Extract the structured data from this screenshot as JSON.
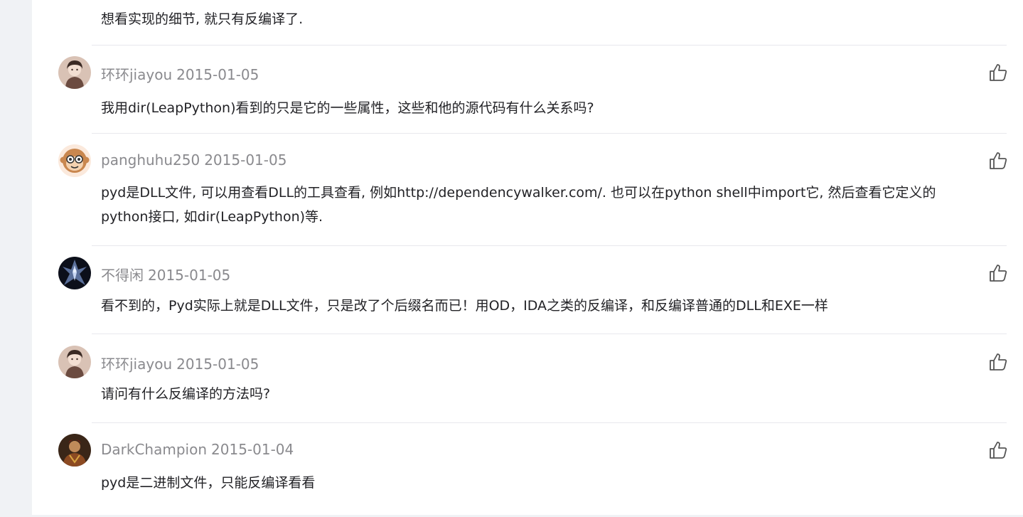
{
  "top_reply_text": "想看实现的细节, 就只有反编译了.",
  "comments": [
    {
      "user": "环环jiayou",
      "date": "2015-01-05",
      "text": "我用dir(LeapPython)看到的只是它的一些属性，这些和他的源代码有什么关系吗?",
      "avatar_icon": "girl-portrait-avatar"
    },
    {
      "user": "panghuhu250",
      "date": "2015-01-05",
      "text": "pyd是DLL文件, 可以用查看DLL的工具查看, 例如http://dependencywalker.com/. 也可以在python shell中import它, 然后查看它定义的python接口, 如dir(LeapPython)等.",
      "avatar_icon": "monkey-face-avatar"
    },
    {
      "user": "不得闲",
      "date": "2015-01-05",
      "text": "看不到的，Pyd实际上就是DLL文件，只是改了个后缀名而已！用OD，IDA之类的反编译，和反编译普通的DLL和EXE一样",
      "avatar_icon": "dark-warrior-avatar"
    },
    {
      "user": "环环jiayou",
      "date": "2015-01-05",
      "text": "请问有什么反编译的方法吗?",
      "avatar_icon": "girl-portrait-avatar"
    },
    {
      "user": "DarkChampion",
      "date": "2015-01-04",
      "text": "pyd是二进制文件，只能反编译看看",
      "avatar_icon": "warrior-avatar"
    }
  ],
  "like_icon": "thumbs-up-icon"
}
